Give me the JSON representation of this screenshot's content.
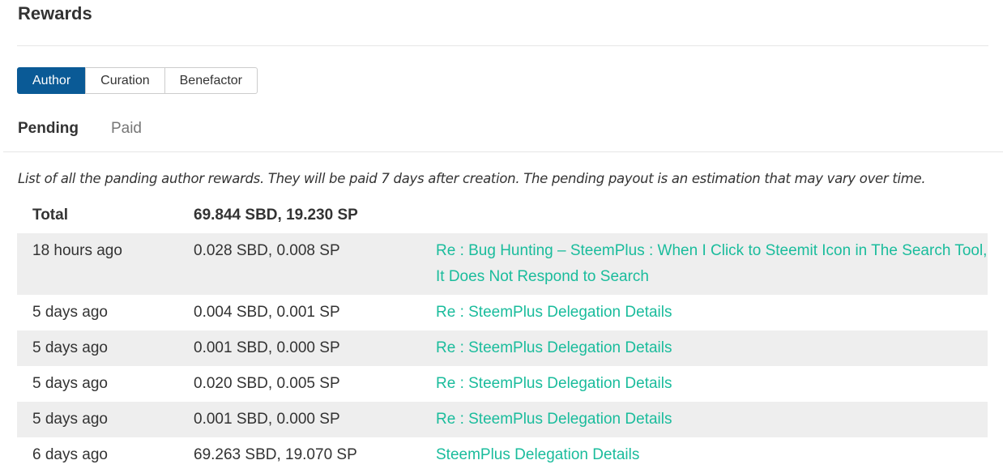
{
  "header": {
    "title": "Rewards"
  },
  "reward_tabs": [
    {
      "label": "Author",
      "active": true
    },
    {
      "label": "Curation",
      "active": false
    },
    {
      "label": "Benefactor",
      "active": false
    }
  ],
  "status_tabs": [
    {
      "label": "Pending",
      "active": true
    },
    {
      "label": "Paid",
      "active": false
    }
  ],
  "description": "List of all the panding author rewards. They will be paid 7 days after creation. The pending payout is an estimation that may vary over time.",
  "table": {
    "total_label": "Total",
    "total_value": "69.844 SBD, 19.230 SP",
    "rows": [
      {
        "time": "18 hours ago",
        "amount": "0.028 SBD, 0.008 SP",
        "post": "Re : Bug Hunting – SteemPlus : When I Click to Steemit Icon in The Search Tool, It Does Not Respond to Search"
      },
      {
        "time": "5 days ago",
        "amount": "0.004 SBD, 0.001 SP",
        "post": "Re : SteemPlus Delegation Details"
      },
      {
        "time": "5 days ago",
        "amount": "0.001 SBD, 0.000 SP",
        "post": "Re : SteemPlus Delegation Details"
      },
      {
        "time": "5 days ago",
        "amount": "0.020 SBD, 0.005 SP",
        "post": "Re : SteemPlus Delegation Details"
      },
      {
        "time": "5 days ago",
        "amount": "0.001 SBD, 0.000 SP",
        "post": "Re : SteemPlus Delegation Details"
      },
      {
        "time": "6 days ago",
        "amount": "69.263 SBD, 19.070 SP",
        "post": "SteemPlus Delegation Details"
      }
    ]
  },
  "colors": {
    "accent": "#0a5a96",
    "link": "#1abc9c",
    "row_alt": "#eeeeee"
  }
}
